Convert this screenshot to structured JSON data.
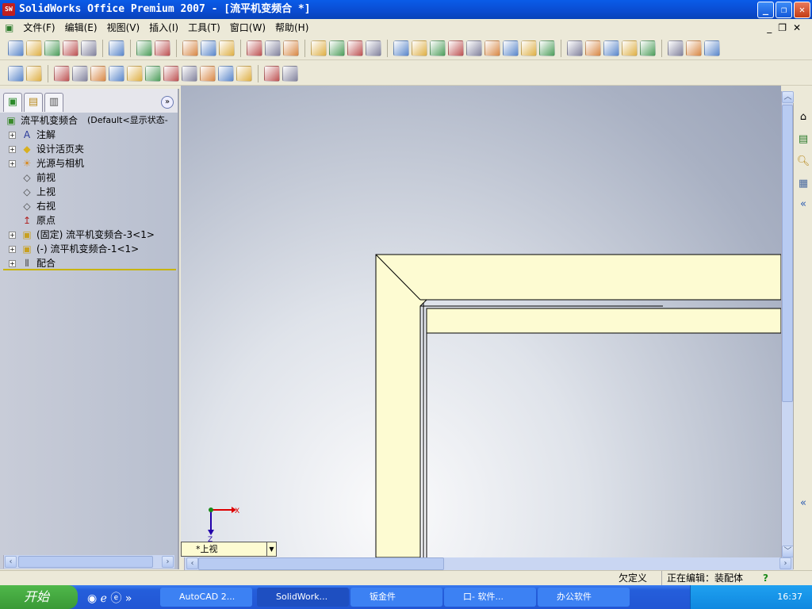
{
  "window": {
    "title": "SolidWorks Office Premium 2007 - [流平机变频合 *]",
    "logo": "SW"
  },
  "menu": [
    "文件(F)",
    "编辑(E)",
    "视图(V)",
    "插入(I)",
    "工具(T)",
    "窗口(W)",
    "帮助(H)"
  ],
  "toolbar1": [
    "new-icon",
    "open-icon",
    "save-icon",
    "print-preview-icon",
    "assembly-icon",
    "|",
    "print-icon",
    "|",
    "undo-icon",
    "redo-icon",
    "|",
    "select-icon",
    "filter-icon",
    "rebuild-icon",
    "|",
    "color-icon",
    "equation-icon",
    "measure-icon",
    "|",
    "solidworks-icon",
    "window-icon",
    "options-icon",
    "help-icon",
    "|",
    "sketch-icon",
    "zoom-fit-icon",
    "zoom-area-icon",
    "zoom-in-icon",
    "zoom-prev-icon",
    "rotate-icon",
    "pan-icon",
    "view-orient-icon",
    "standard-views-icon",
    "|",
    "wireframe-icon",
    "hidden-lines-icon",
    "hidden-removed-icon",
    "shaded-edges-icon",
    "shaded-icon",
    "|",
    "section-icon",
    "perspective-icon",
    "shadow-icon"
  ],
  "toolbar2": [
    "component-icon",
    "smart-dimension-icon",
    "|",
    "insert-component-icon",
    "hide-icon",
    "move-icon",
    "rotate-component-icon",
    "interference-icon",
    "mate-icon",
    "smart-fastener-icon",
    "explode-icon",
    "hole-wizard-icon",
    "exploded-line-icon",
    "collision-icon",
    "|",
    "assembly-feature-icon",
    "gear-icon"
  ],
  "feature_tree": {
    "tabs": [
      "featuremanager-tab",
      "propertymanager-tab",
      "configmanager-tab"
    ],
    "root": "流平机变频合",
    "root_config": "(Default<显示状态-",
    "items": [
      {
        "label": "注解",
        "icon": "annotations-icon",
        "expand": true
      },
      {
        "label": "设计活页夹",
        "icon": "design-binder-icon",
        "expand": true
      },
      {
        "label": "光源与相机",
        "icon": "lights-cameras-icon",
        "expand": true
      },
      {
        "label": "前视",
        "icon": "plane-icon",
        "expand": false
      },
      {
        "label": "上视",
        "icon": "plane-icon",
        "expand": false
      },
      {
        "label": "右视",
        "icon": "plane-icon",
        "expand": false
      },
      {
        "label": "原点",
        "icon": "origin-icon",
        "expand": false
      },
      {
        "label": "(固定) 流平机变频合-3<1>",
        "icon": "part-icon",
        "expand": true
      },
      {
        "label": "(-) 流平机变频合-1<1>",
        "icon": "part-icon",
        "expand": true
      },
      {
        "label": "配合",
        "icon": "mates-icon",
        "expand": true
      }
    ]
  },
  "viewport": {
    "view_name": "*上视",
    "axis_x": "X",
    "axis_z": "Z",
    "part_color": "#fdfbd2"
  },
  "status": {
    "definition": "欠定义",
    "editing": "正在编辑：装配体",
    "help": "?"
  },
  "taskbar": {
    "start": "开始",
    "tasks": [
      "AutoCAD 2...",
      "SolidWork...",
      "钣金件",
      "口- 软件...",
      "办公软件"
    ],
    "clock": "16:37"
  }
}
